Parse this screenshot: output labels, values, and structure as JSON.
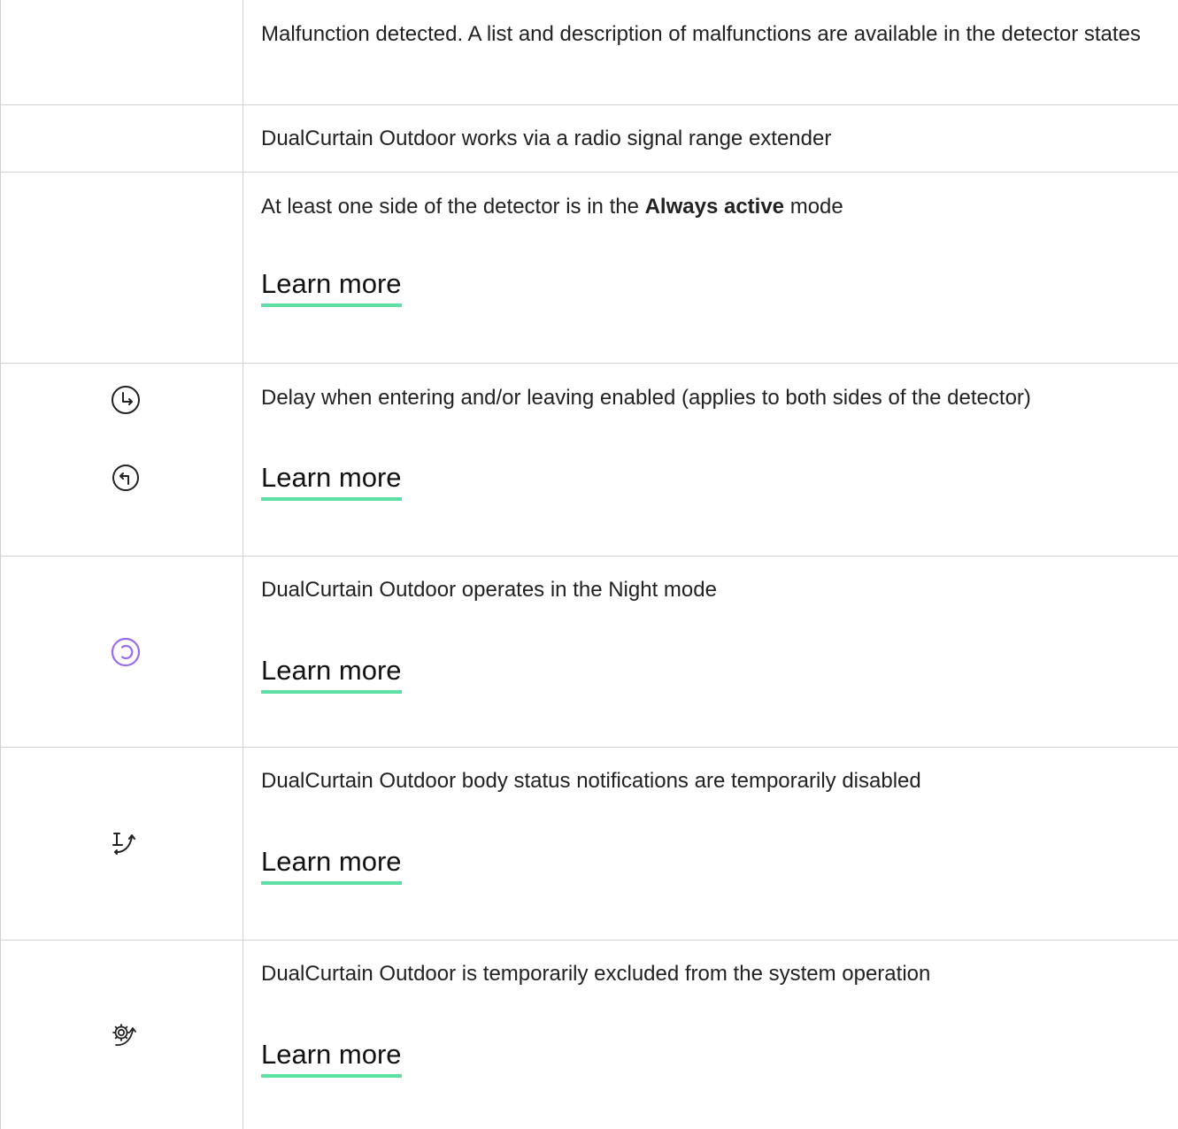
{
  "rows": [
    {
      "text": "Malfunction detected. A list and description of malfunctions are available in the detector states"
    },
    {
      "text": "DualCurtain Outdoor works via a radio signal range extender"
    },
    {
      "text_before": "At least one side of the detector is in the ",
      "text_bold": "Always active",
      "text_after": " mode",
      "link": "Learn more"
    },
    {
      "icons": [
        "entry-delay-icon",
        "exit-delay-icon"
      ],
      "text": "Delay when entering and/or leaving enabled (applies to both sides of the detector)",
      "link": "Learn more"
    },
    {
      "icons": [
        "night-mode-icon"
      ],
      "text": "DualCurtain Outdoor operates in the Night mode",
      "link": "Learn more"
    },
    {
      "icons": [
        "lid-notifications-disabled-icon"
      ],
      "text": "DualCurtain Outdoor body status notifications are temporarily disabled",
      "link": "Learn more"
    },
    {
      "icons": [
        "device-deactivated-icon"
      ],
      "text": "DualCurtain Outdoor is temporarily excluded from the system operation",
      "link": "Learn more"
    }
  ],
  "colors": {
    "border": "#d0d0d0",
    "link_underline": "#5ce0a4",
    "night_mode_icon": "#9b6cf2",
    "text": "#222222"
  }
}
